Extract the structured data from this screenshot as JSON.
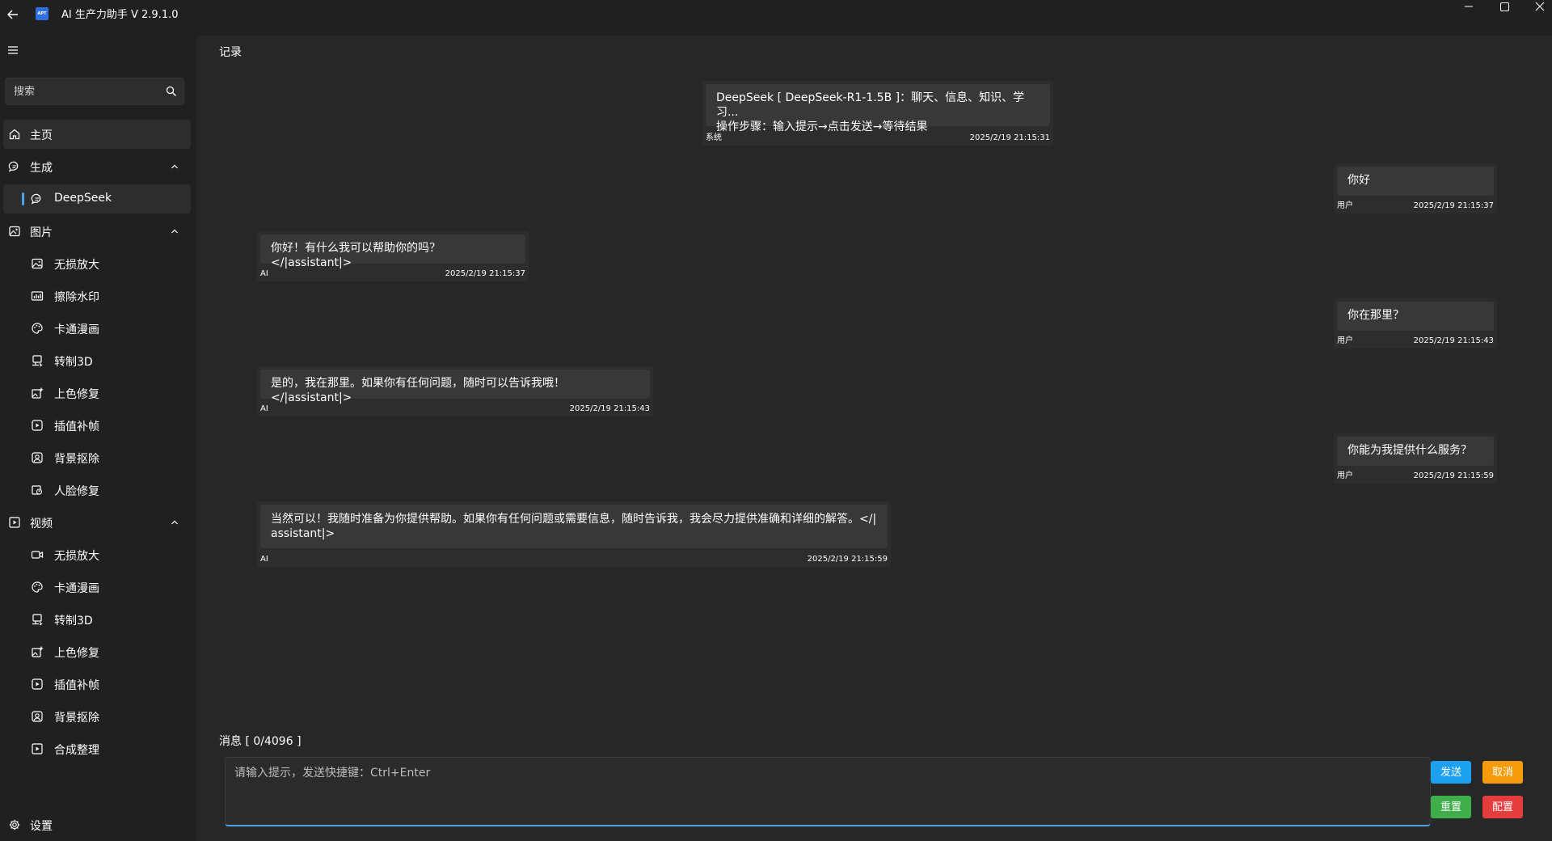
{
  "app": {
    "title": "AI 生产力助手 V 2.9.1.0",
    "logo_text": "APT"
  },
  "sidebar": {
    "search_placeholder": "搜索",
    "home": "主页",
    "generate": {
      "label": "生成",
      "items": [
        "DeepSeek"
      ]
    },
    "image": {
      "label": "图片",
      "items": [
        "无损放大",
        "擦除水印",
        "卡通漫画",
        "转制3D",
        "上色修复",
        "插值补帧",
        "背景抠除",
        "人脸修复"
      ]
    },
    "video": {
      "label": "视频",
      "items": [
        "无损放大",
        "卡通漫画",
        "转制3D",
        "上色修复",
        "插值补帧",
        "背景抠除",
        "合成整理"
      ]
    },
    "settings": "设置"
  },
  "main": {
    "record_title": "记录",
    "messages": [
      {
        "who": "系统",
        "line1": "DeepSeek [ DeepSeek-R1-1.5B ]：聊天、信息、知识、学习...",
        "line2": "操作步骤：输入提示→点击发送→等待结果",
        "time": "2025/2/19 21:15:31"
      },
      {
        "who": "用户",
        "text": "你好",
        "time": "2025/2/19 21:15:37"
      },
      {
        "who": "AI",
        "text": "你好！有什么我可以帮助你的吗？</|assistant|>",
        "time": "2025/2/19 21:15:37"
      },
      {
        "who": "用户",
        "text": "你在那里？",
        "time": "2025/2/19 21:15:43"
      },
      {
        "who": "AI",
        "text": "是的，我在那里。如果你有任何问题，随时可以告诉我哦！</|assistant|>",
        "time": "2025/2/19 21:15:43"
      },
      {
        "who": "用户",
        "text": "你能为我提供什么服务？",
        "time": "2025/2/19 21:15:59"
      },
      {
        "who": "AI",
        "line1": "当然可以！我随时准备为你提供帮助。如果你有任何问题或需要信息，随时告诉我，我会尽力提供准确和详细的解答。</|",
        "line2": "assistant|>",
        "time": "2025/2/19 21:15:59"
      }
    ],
    "message_label": "消息 [ 0/4096 ]",
    "input_placeholder": "请输入提示，发送快捷键：Ctrl+Enter",
    "buttons": {
      "send": "发送",
      "cancel": "取消",
      "reset": "重置",
      "config": "配置"
    }
  }
}
